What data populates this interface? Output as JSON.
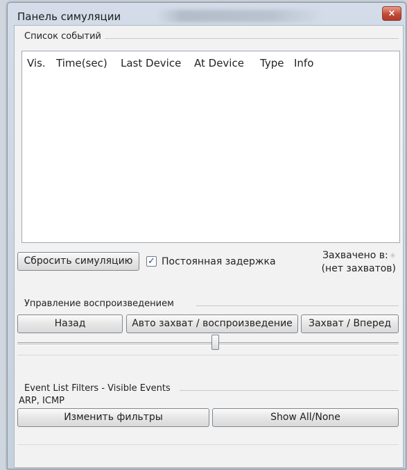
{
  "window": {
    "title": "Панель симуляции",
    "close_label": "×"
  },
  "event_list": {
    "group_label": "Список событий",
    "columns": [
      "Vis.",
      "Time(sec)",
      "Last Device",
      "At Device",
      "Type",
      "Info"
    ]
  },
  "controls": {
    "reset_label": "Сбросить симуляцию",
    "constant_delay_label": "Постоянная задержка",
    "constant_delay_checked": true,
    "captured_label": "Захвачено в:",
    "captured_value": "(нет захватов)"
  },
  "playback": {
    "group_label": "Управление воспроизведением",
    "back_label": "Назад",
    "auto_label": "Авто захват / воспроизведение",
    "forward_label": "Захват / Вперед",
    "speed_fraction": 0.52
  },
  "filters": {
    "group_label": "Event List Filters - Visible Events",
    "value": "ARP, ICMP",
    "edit_label": "Изменить фильтры",
    "show_all_label": "Show All/None"
  }
}
